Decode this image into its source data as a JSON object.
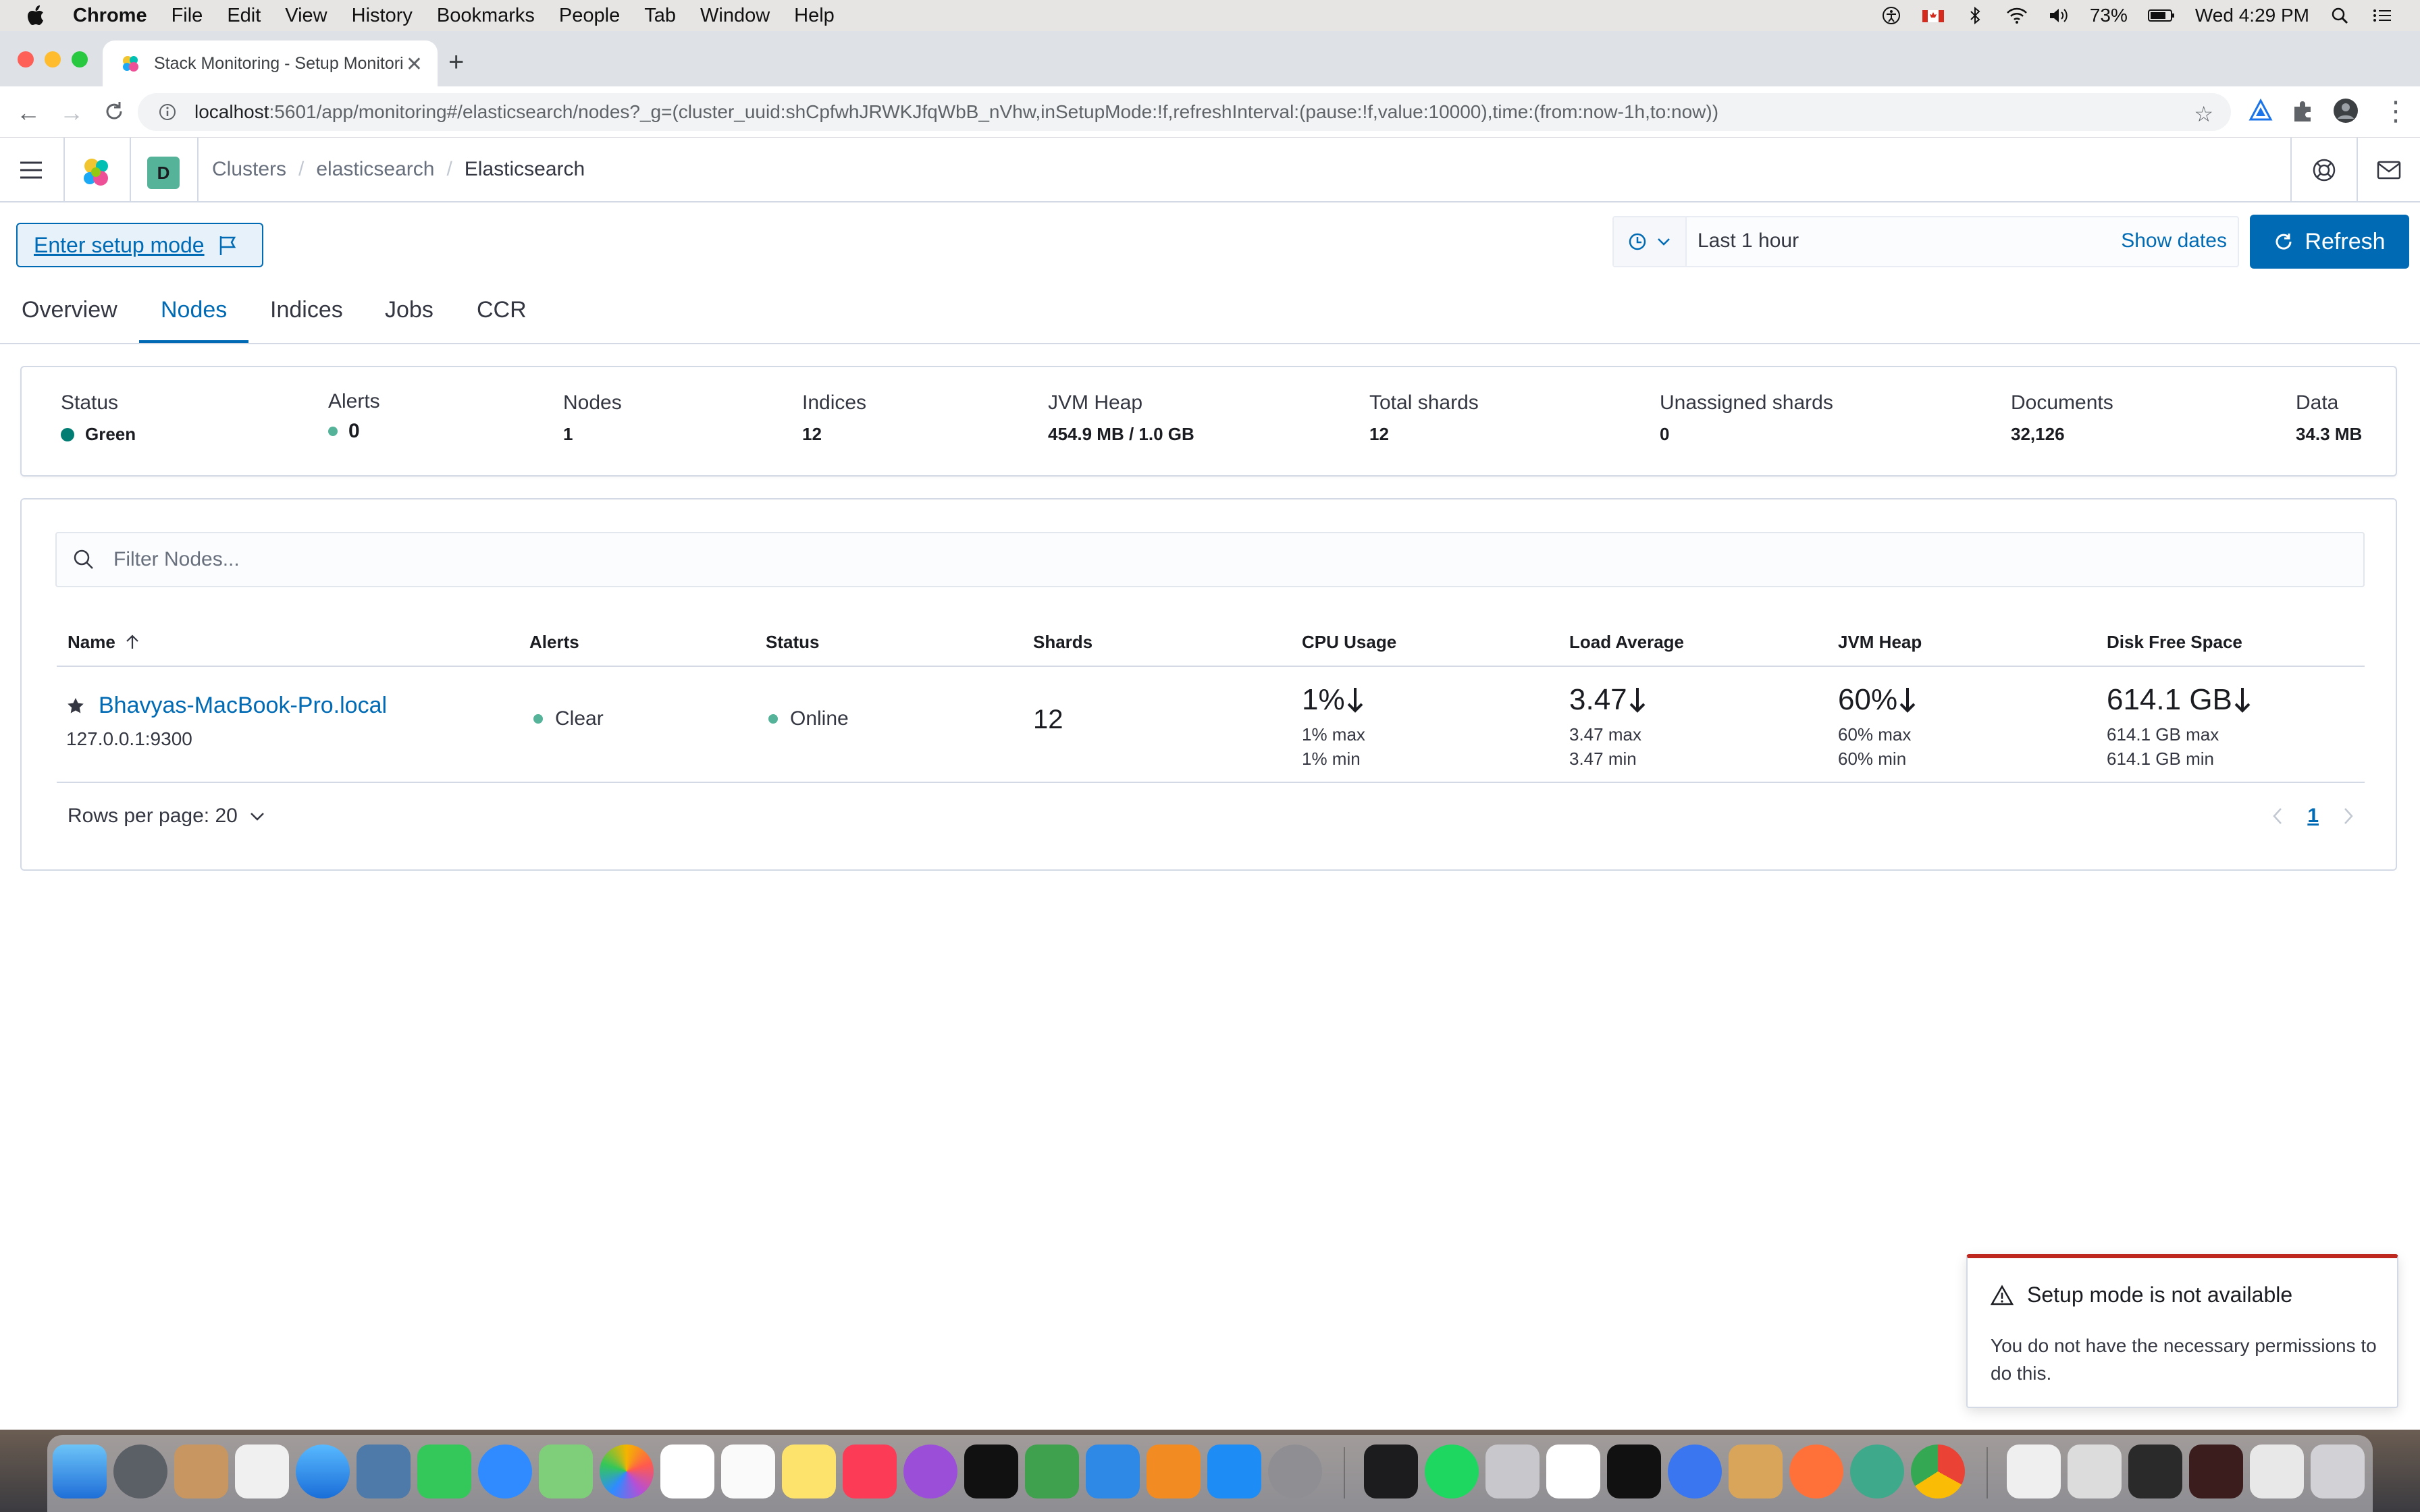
{
  "menubar": {
    "app_name": "Chrome",
    "items": [
      "File",
      "Edit",
      "View",
      "History",
      "Bookmarks",
      "People",
      "Tab",
      "Window",
      "Help"
    ],
    "battery": "73%",
    "clock": "Wed 4:29 PM"
  },
  "browser": {
    "tab_title": "Stack Monitoring - Setup Monitoring",
    "url_host": "localhost",
    "url_path": ":5601/app/monitoring#/elasticsearch/nodes?_g=(cluster_uuid:shCpfwhJRWKJfqWbB_nVhw,inSetupMode:!f,refreshInterval:(pause:!f,value:10000),time:(from:now-1h,to:now))"
  },
  "header": {
    "space_initial": "D",
    "breadcrumbs": [
      "Clusters",
      "elasticsearch"
    ],
    "breadcrumb_current": "Elasticsearch"
  },
  "toolbar": {
    "setup_mode_label": "Enter setup mode",
    "time_value": "Last 1 hour",
    "show_dates_label": "Show dates",
    "refresh_label": "Refresh"
  },
  "tabs": [
    "Overview",
    "Nodes",
    "Indices",
    "Jobs",
    "CCR"
  ],
  "active_tab": "Nodes",
  "summary": {
    "status_label": "Status",
    "status_value": "Green",
    "alerts_label": "Alerts",
    "alerts_value": "0",
    "nodes_label": "Nodes",
    "nodes_value": "1",
    "indices_label": "Indices",
    "indices_value": "12",
    "jvm_label": "JVM Heap",
    "jvm_value": "454.9 MB / 1.0 GB",
    "shards_label": "Total shards",
    "shards_value": "12",
    "unassigned_label": "Unassigned shards",
    "unassigned_value": "0",
    "documents_label": "Documents",
    "documents_value": "32,126",
    "data_label": "Data",
    "data_value": "34.3 MB"
  },
  "table": {
    "filter_placeholder": "Filter Nodes...",
    "columns": [
      "Name",
      "Alerts",
      "Status",
      "Shards",
      "CPU Usage",
      "Load Average",
      "JVM Heap",
      "Disk Free Space"
    ],
    "row": {
      "name": "Bhavyas-MacBook-Pro.local",
      "address": "127.0.0.1:9300",
      "alerts": "Clear",
      "status": "Online",
      "shards": "12",
      "cpu": {
        "value": "1%",
        "max": "1% max",
        "min": "1% min"
      },
      "load": {
        "value": "3.47",
        "max": "3.47 max",
        "min": "3.47 min"
      },
      "jvm": {
        "value": "60%",
        "max": "60% max",
        "min": "60% min"
      },
      "disk": {
        "value": "614.1 GB",
        "max": "614.1 GB max",
        "min": "614.1 GB min"
      }
    },
    "rows_per_page": "Rows per page: 20",
    "current_page": "1"
  },
  "toast": {
    "title": "Setup mode is not available",
    "body": "You do not have the necessary permissions to do this."
  },
  "colors": {
    "primary": "#006bb4",
    "success": "#017d73",
    "danger": "#bd271e",
    "border": "#d3dae6"
  }
}
